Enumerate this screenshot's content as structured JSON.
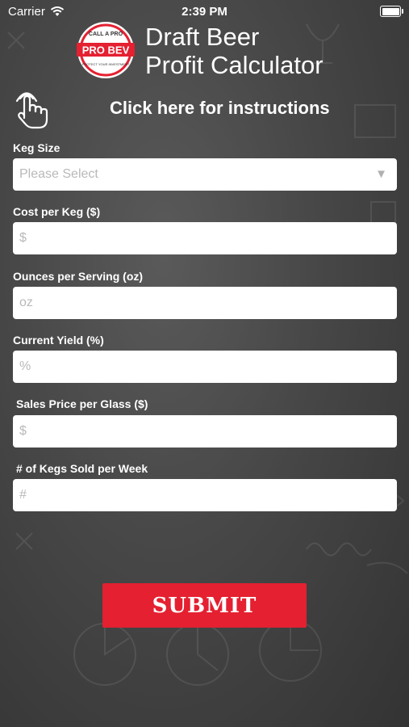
{
  "status_bar": {
    "carrier": "Carrier",
    "time": "2:39 PM"
  },
  "logo": {
    "brand": "PRO BEV",
    "top_text": "CALL A PRO",
    "bottom_text": "PROTECT YOUR INVESTMENT"
  },
  "header": {
    "title_line1": "Draft Beer",
    "title_line2": "Profit Calculator"
  },
  "instructions": {
    "label": "Click here for instructions"
  },
  "form": {
    "keg_size": {
      "label": "Keg Size",
      "placeholder": "Please Select"
    },
    "cost_per_keg": {
      "label": "Cost per Keg ($)",
      "placeholder": "$",
      "value": ""
    },
    "ounces_per_serving": {
      "label": "Ounces per Serving (oz)",
      "placeholder": "oz",
      "value": ""
    },
    "current_yield": {
      "label": "Current Yield (%)",
      "placeholder": "%",
      "value": ""
    },
    "sales_price": {
      "label": "Sales Price per Glass ($)",
      "placeholder": "$",
      "value": ""
    },
    "kegs_sold": {
      "label": "# of Kegs Sold per Week",
      "placeholder": "#",
      "value": ""
    }
  },
  "submit": {
    "label": "SUBMIT"
  },
  "colors": {
    "accent": "#e42031",
    "background": "#474747"
  }
}
